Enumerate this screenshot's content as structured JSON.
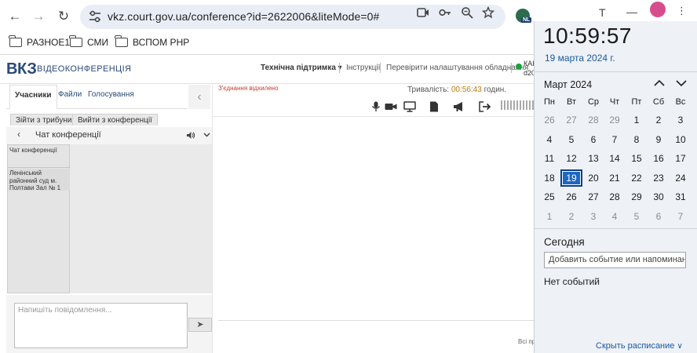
{
  "browser": {
    "url": "vkz.court.gov.ua/conference?id=2622006&liteMode=0#",
    "extension_badge": "NL",
    "bookmarks": [
      "РАЗНОЕ1",
      "СМИ",
      "ВСПОМ РНР"
    ]
  },
  "app": {
    "logo_main": "ВКЗ",
    "logo_sub": "ВІДЕОКОНФЕРЕНЦІЯ",
    "header_links": {
      "support": "Технічна підтримка ▾",
      "instructions": "Інструкції",
      "check": "Перевірити налаштування обладнання"
    },
    "status_cut_top": "КАН",
    "status_cut_bottom": "d20",
    "tabs": [
      "Учасники",
      "Файли",
      "Голосування"
    ],
    "buttons": {
      "tribune": "Зійти з трибуни",
      "leave": "Вийти з конференції"
    },
    "chat": {
      "title": "Чат конференції",
      "list_label": "Чат конференції",
      "participant": "Ленінський районний суд м. Полтави Зал № 1",
      "placeholder": "Напишіть повідомлення..."
    },
    "conference": {
      "connection_lost": "З'єднання відхилено",
      "duration_label": "Тривалість:",
      "duration_value": "00:56:43",
      "duration_unit": "годин.",
      "bottom_cut": "Всі пр"
    }
  },
  "flyout": {
    "time": "10:59:57",
    "date": "19 марта 2024 г.",
    "month": "Март 2024",
    "weekdays": [
      "Пн",
      "Вт",
      "Ср",
      "Чт",
      "Пт",
      "Сб",
      "Вс"
    ],
    "weeks": [
      [
        "26",
        "27",
        "28",
        "29",
        "1",
        "2",
        "3"
      ],
      [
        "4",
        "5",
        "6",
        "7",
        "8",
        "9",
        "10"
      ],
      [
        "11",
        "12",
        "13",
        "14",
        "15",
        "16",
        "17"
      ],
      [
        "18",
        "19",
        "20",
        "21",
        "22",
        "23",
        "24"
      ],
      [
        "25",
        "26",
        "27",
        "28",
        "29",
        "30",
        "31"
      ],
      [
        "1",
        "2",
        "3",
        "4",
        "5",
        "6",
        "7"
      ]
    ],
    "today_heading": "Сегодня",
    "add_event_placeholder": "Добавить событие или напоминание",
    "no_events": "Нет событий",
    "show_schedule": "Скрыть расписание"
  }
}
